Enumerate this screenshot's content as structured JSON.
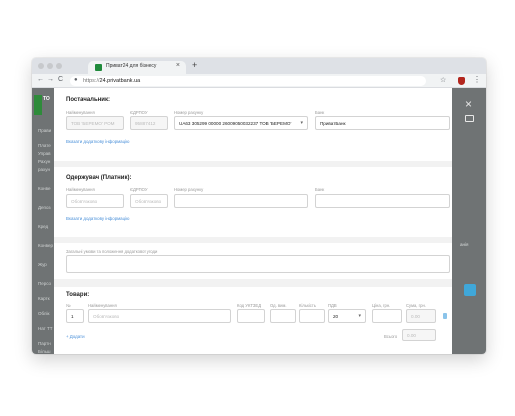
{
  "browser": {
    "tab_title": "Приват24 для бізнесу",
    "tab_close": "×",
    "new_tab": "+",
    "nav": {
      "back": "←",
      "forward": "→",
      "reload": "C"
    },
    "url_prefix": "https://",
    "url_host": "24.privatbank.ua",
    "star": "☆",
    "menu": "⋮"
  },
  "background": {
    "logo_text": "ТО",
    "sidebar_items": [
      "Прави",
      "Плате",
      "Управ",
      "Рахун",
      "рахун",
      "Конве",
      "Депоз",
      "Кред",
      "Конвер",
      "Жур",
      "Персо",
      "Картк",
      "Облік",
      "Нат ТТ",
      "Партн",
      "Більш"
    ],
    "right_text": "анія",
    "close": "×"
  },
  "form": {
    "supplier": {
      "title": "Постачальник:",
      "name_label": "Найменування",
      "name_value": "ТОВ 'БЕРЕМО' РОМ",
      "edrpou_label": "ЄДРПОУ",
      "edrpou_value": "95887412",
      "account_label": "Номер рахунку",
      "account_value": "UA63 305299 00000 26009050032237 ТОВ 'БЕРЕМО'",
      "bank_label": "Банк",
      "bank_value": "ПриватБанк",
      "more_link": "Вказати додаткову інформацію"
    },
    "payer": {
      "title": "Одержувач (Платник):",
      "name_label": "Найменування",
      "name_placeholder": "Обов'язково",
      "edrpou_label": "ЄДРПОУ",
      "edrpou_placeholder": "Обов'язково",
      "account_label": "Номер рахунку",
      "bank_label": "Банк",
      "more_link": "Вказати додаткову інформацію"
    },
    "terms": {
      "label": "Загальні умови та положення додаткової угоди"
    },
    "goods": {
      "title": "Товари:",
      "columns": {
        "num": "№",
        "name": "Найменування",
        "uktzed": "Код УКТЗЕД",
        "unit": "Од. вим.",
        "qty": "Кількість",
        "vat": "ПДВ",
        "price": "Ціна, грн.",
        "sum": "Сума, грн."
      },
      "row": {
        "num": "1",
        "name_placeholder": "Обов'язково",
        "vat": "20",
        "sum": "0.00"
      },
      "add_link": "+ Додати",
      "total_label": "Всього",
      "total_value": "0.00"
    }
  }
}
